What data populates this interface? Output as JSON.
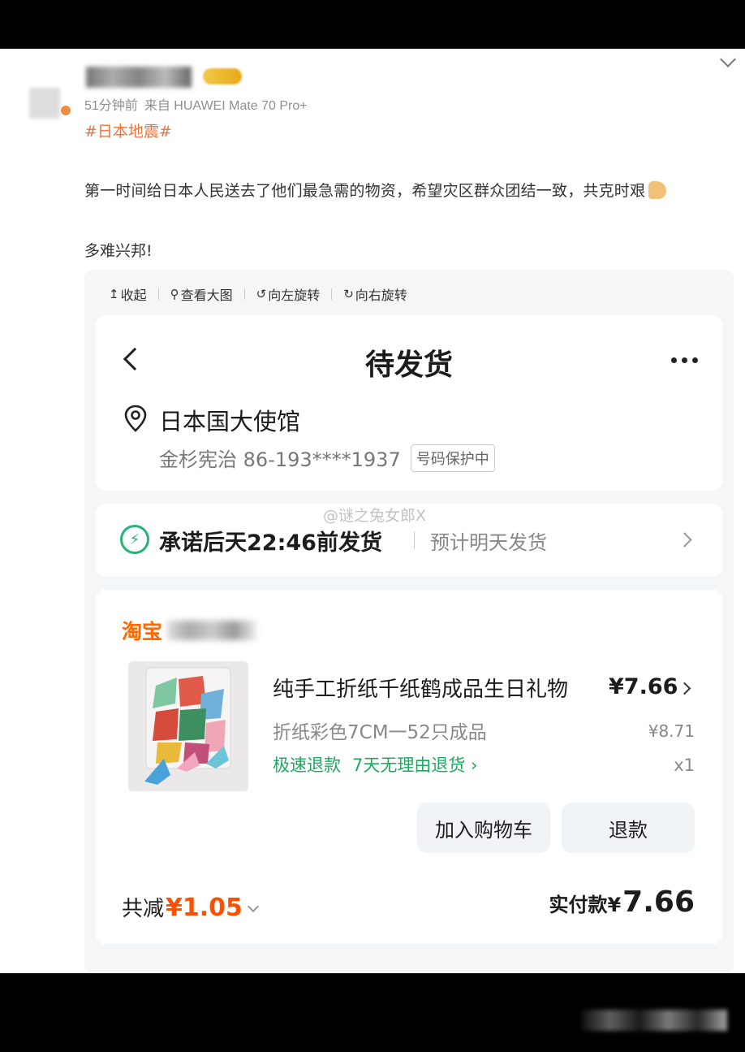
{
  "post": {
    "time": "51分钟前",
    "source": "来自 HUAWEI Mate 70 Pro+",
    "hashtag": "#日本地震#",
    "text_line1": "第一时间给日本人民送去了他们最急需的物资，希望灾区群众团结一致，共克时艰",
    "text_line2": "多难兴邦!"
  },
  "image_toolbar": {
    "collapse": "收起",
    "view_large": "查看大图",
    "rotate_left": "向左旋转",
    "rotate_right": "向右旋转"
  },
  "order": {
    "title": "待发货",
    "address_name": "日本国大使馆",
    "recipient": "金杉宪治 86-193****1937",
    "number_protection": "号码保护中",
    "watermark": "@谜之兔女郎X",
    "promise": "承诺后天22:46前发货",
    "estimate": "预计明天发货",
    "shop": "淘宝",
    "product_name": "纯手工折纸千纸鹤成品生日礼物",
    "price": "¥7.66",
    "sku": "折纸彩色7CM一52只成品",
    "original_price": "¥8.71",
    "service_fast_refund": "极速退款",
    "service_7day": "7天无理由退货 ›",
    "quantity": "x1",
    "add_to_cart": "加入购物车",
    "refund": "退款",
    "discount_label": "共减",
    "discount_value": "¥1.05",
    "paid_label": "实付款¥",
    "paid_value": "7.66"
  },
  "colors": {
    "hashtag": "#eb7340",
    "taobao_orange": "#ff6a00",
    "discount_red": "#ff5000",
    "service_green": "#1fa85f",
    "promise_green": "#24b573"
  }
}
